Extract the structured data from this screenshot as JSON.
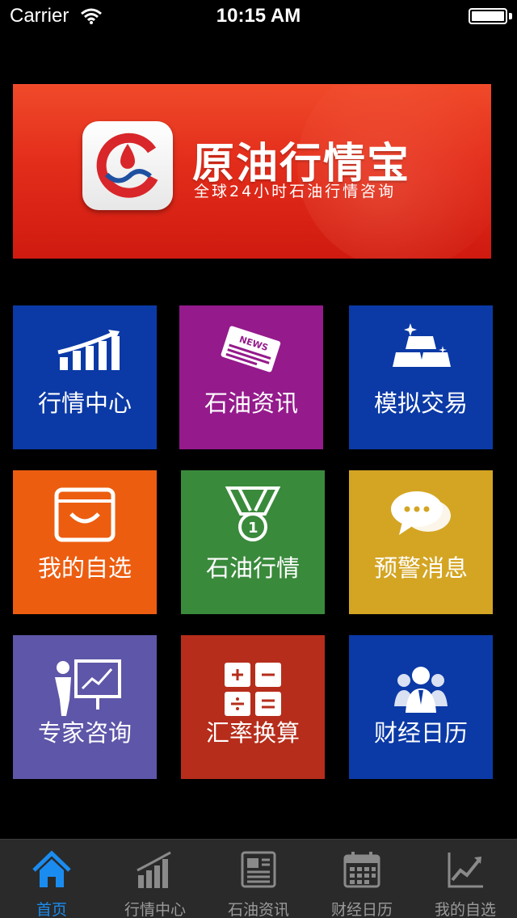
{
  "status_bar": {
    "carrier": "Carrier",
    "time": "10:15 AM"
  },
  "banner": {
    "title": "原油行情宝",
    "subtitle": "全球24小时石油行情咨询"
  },
  "tiles": [
    {
      "label": "行情中心",
      "icon": "chart-up-icon",
      "color": "#0b3aa6"
    },
    {
      "label": "石油资讯",
      "icon": "newspaper-icon",
      "color": "#951a8c"
    },
    {
      "label": "模拟交易",
      "icon": "gold-bars-icon",
      "color": "#0b3aa6"
    },
    {
      "label": "我的自选",
      "icon": "basket-icon",
      "color": "#ec5d10"
    },
    {
      "label": "石油行情",
      "icon": "medal-icon",
      "color": "#3a8a3c"
    },
    {
      "label": "预警消息",
      "icon": "chat-bubbles-icon",
      "color": "#d4a523"
    },
    {
      "label": "专家咨询",
      "icon": "presenter-icon",
      "color": "#5e56a8"
    },
    {
      "label": "汇率换算",
      "icon": "calculator-icon",
      "color": "#b62d1b"
    },
    {
      "label": "财经日历",
      "icon": "people-icon",
      "color": "#0b3aa6"
    }
  ],
  "tab_bar": {
    "items": [
      {
        "label": "首页",
        "icon": "home-icon",
        "active": true
      },
      {
        "label": "行情中心",
        "icon": "bar-chart-icon",
        "active": false
      },
      {
        "label": "石油资讯",
        "icon": "news-icon",
        "active": false
      },
      {
        "label": "财经日历",
        "icon": "calendar-icon",
        "active": false
      },
      {
        "label": "我的自选",
        "icon": "line-chart-icon",
        "active": false
      }
    ],
    "active_color": "#1a8cf0",
    "inactive_color": "#9a9a9a"
  }
}
